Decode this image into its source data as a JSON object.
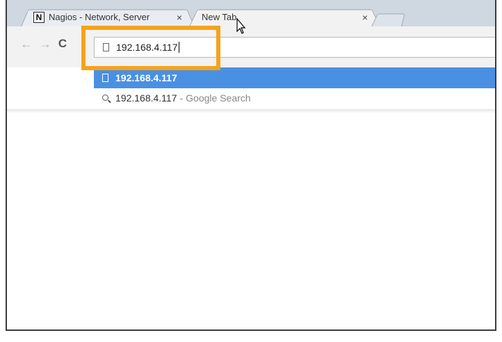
{
  "browser": {
    "tabs": [
      {
        "title": "Nagios - Network, Server",
        "favicon": "N",
        "close": "×",
        "active": false
      },
      {
        "title": "New Tab",
        "close": "×",
        "active": true
      }
    ],
    "toolbar": {
      "back_icon": "←",
      "forward_icon": "→",
      "reload_icon": "C"
    },
    "omnibox": {
      "value": "192.168.4.117"
    },
    "suggestions": [
      {
        "text": "192.168.4.117",
        "icon": "page-icon",
        "selected": true
      },
      {
        "text": "192.168.4.117",
        "separator": "-",
        "source": "Google Search",
        "icon": "search-icon",
        "selected": false
      }
    ]
  },
  "colors": {
    "highlight": "#f7a21b",
    "selection": "#4a90e2"
  }
}
